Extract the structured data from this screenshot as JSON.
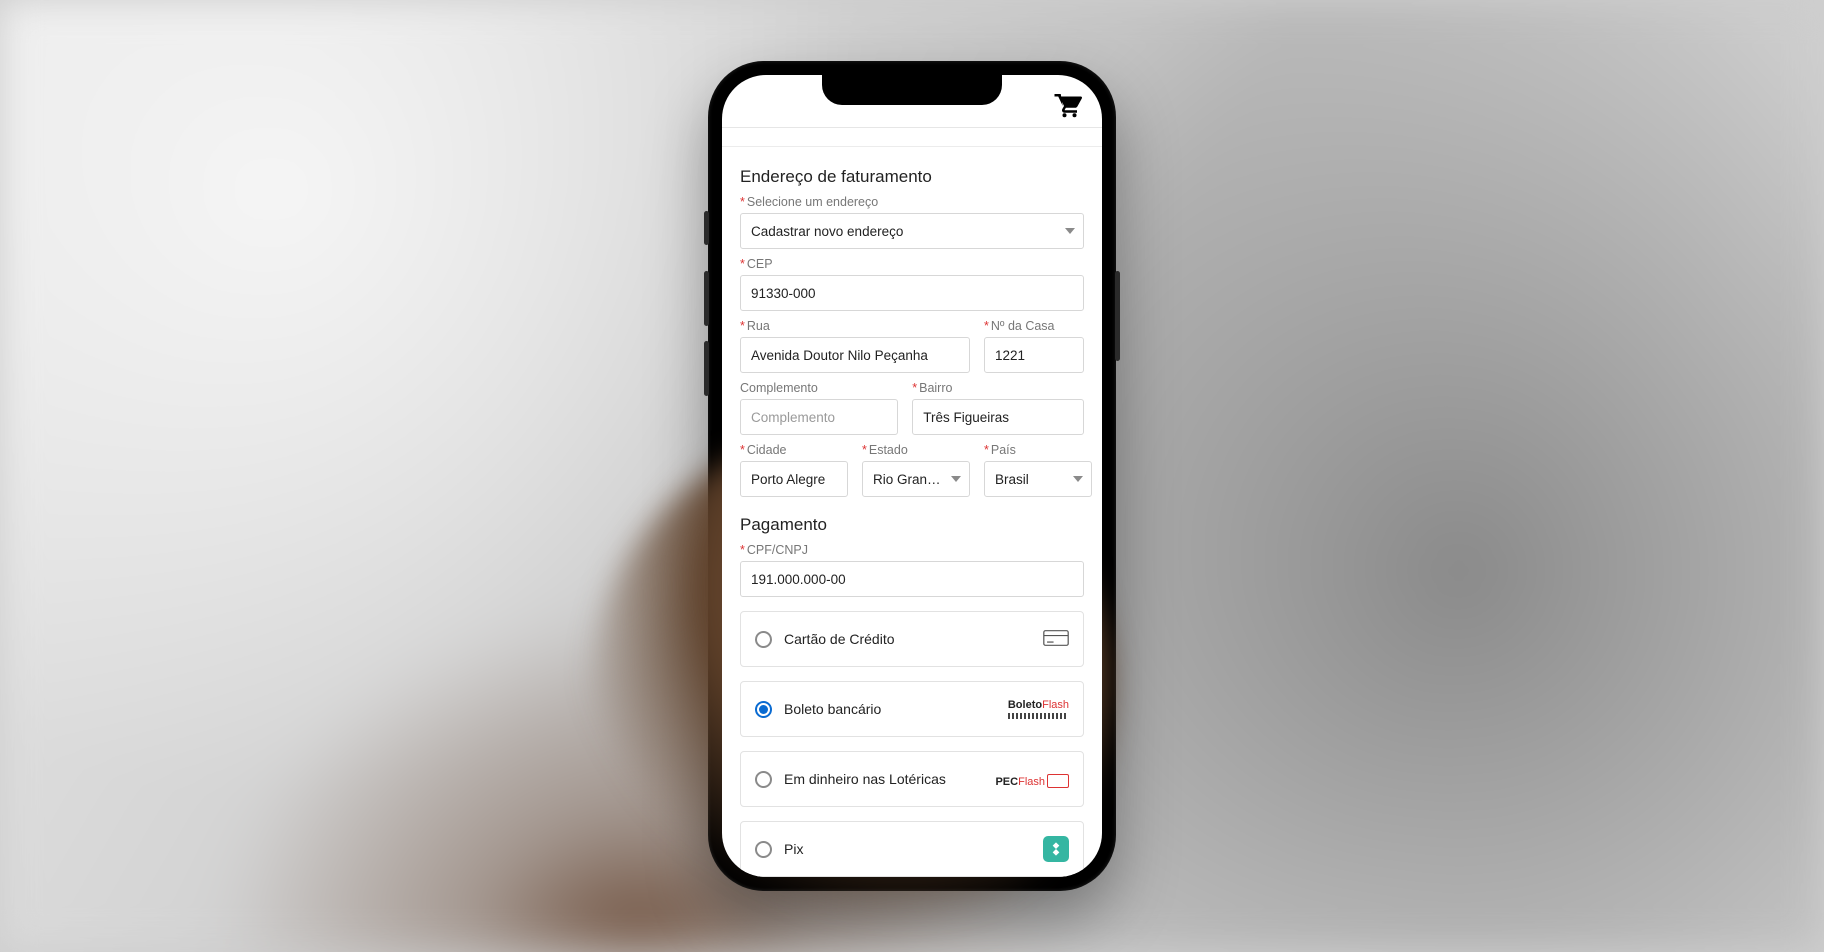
{
  "billing": {
    "heading": "Endereço de faturamento",
    "select_address_label": "Selecione um endereço",
    "select_address_value": "Cadastrar novo endereço",
    "cep_label": "CEP",
    "cep_value": "91330-000",
    "street_label": "Rua",
    "street_value": "Avenida Doutor Nilo Peçanha",
    "number_label": "Nº da Casa",
    "number_value": "1221",
    "complement_label": "Complemento",
    "complement_placeholder": "Complemento",
    "district_label": "Bairro",
    "district_value": "Três Figueiras",
    "city_label": "Cidade",
    "city_value": "Porto Alegre",
    "state_label": "Estado",
    "state_value": "Rio Gran…",
    "country_label": "País",
    "country_value": "Brasil"
  },
  "payment": {
    "heading": "Pagamento",
    "cpf_label": "CPF/CNPJ",
    "cpf_value": "191.000.000-00",
    "options": {
      "credit_card": "Cartão de Crédito",
      "boleto": "Boleto bancário",
      "loterica": "Em dinheiro nas Lotéricas",
      "pix": "Pix"
    },
    "brands": {
      "boleto_prefix": "Boleto",
      "boleto_suffix": "Flash",
      "pec_prefix": "PEC",
      "pec_suffix": "Flash"
    }
  }
}
